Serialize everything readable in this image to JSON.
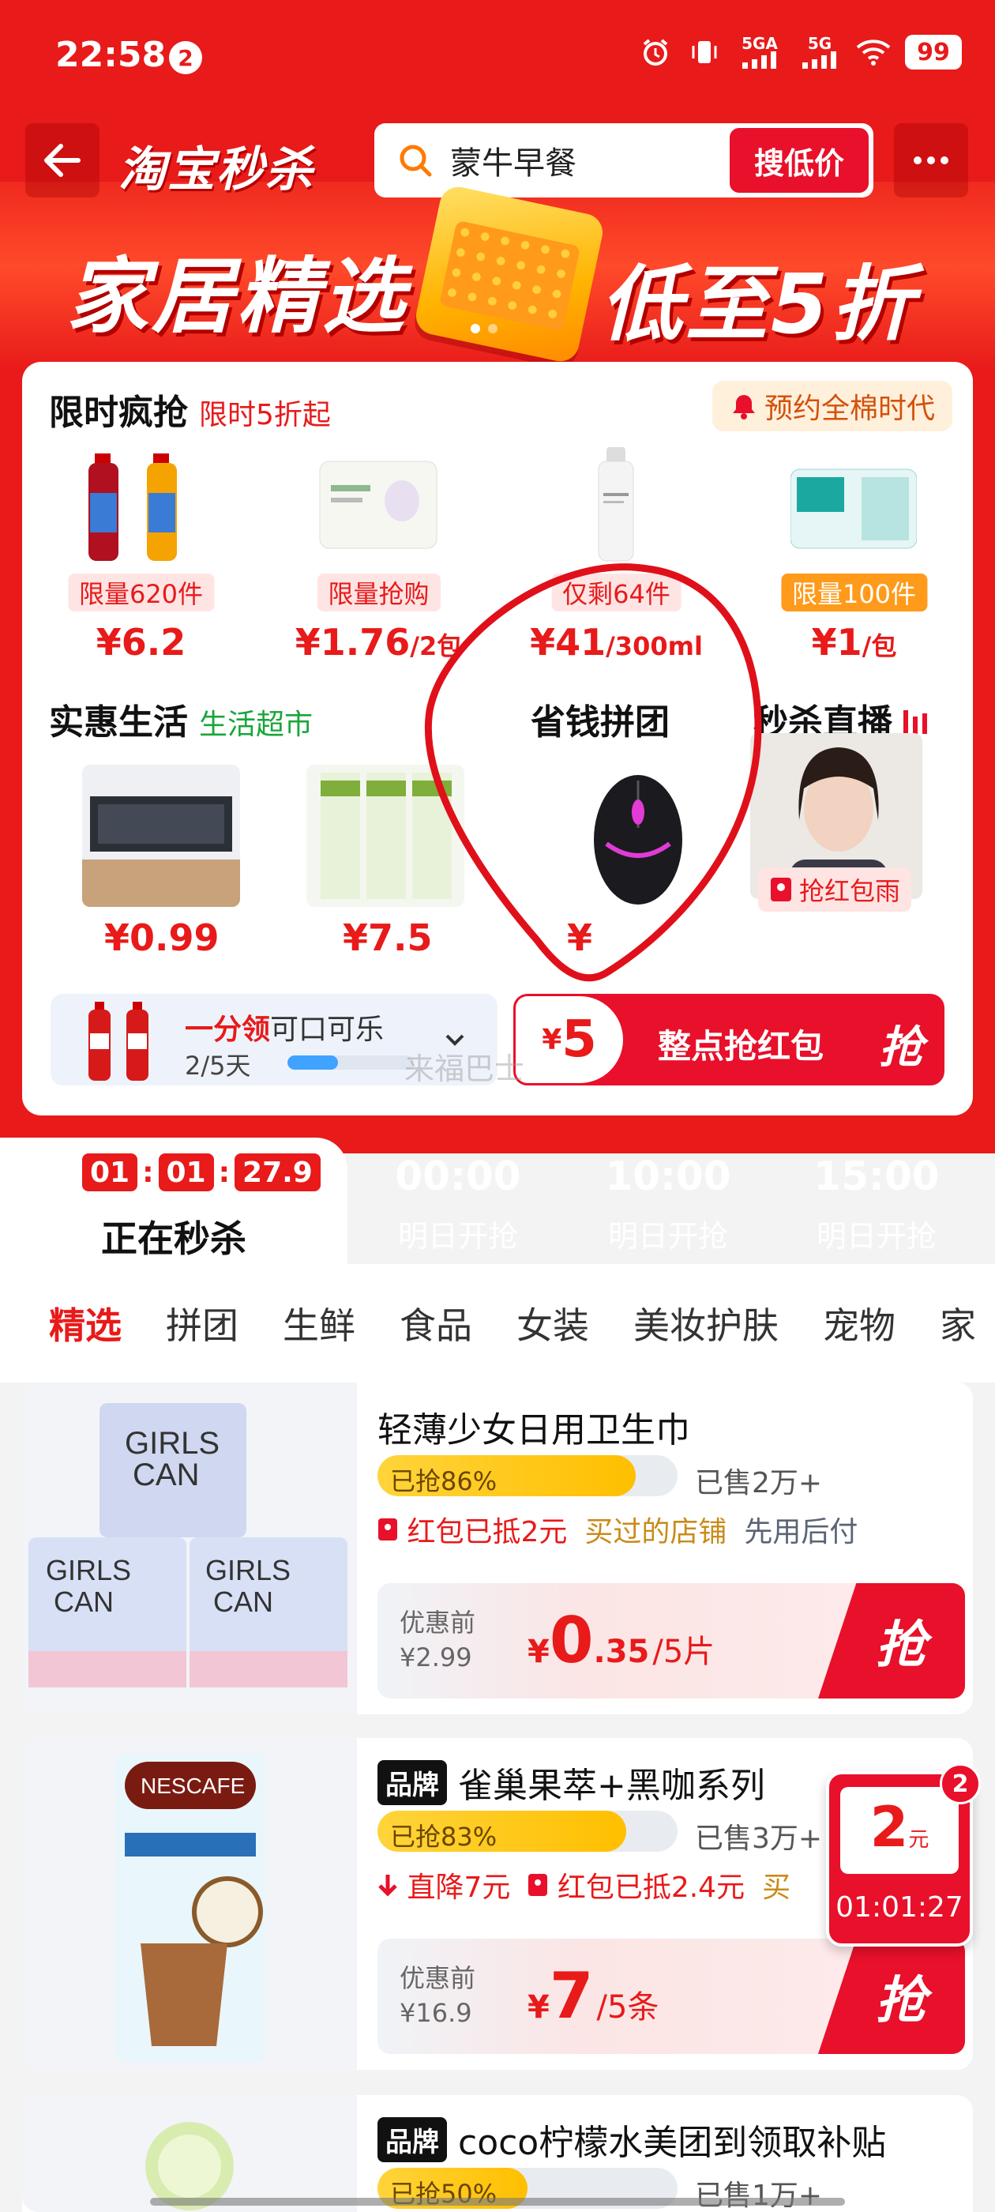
{
  "status_bar": {
    "time": "22:58",
    "notif_count": "2",
    "net1": "5GA",
    "net2": "5G",
    "battery": "99"
  },
  "nav": {
    "brand": "淘宝秒杀",
    "search_value": "蒙牛早餐",
    "search_button": "搜低价"
  },
  "banner": {
    "left_text": "家居精选",
    "right_text": "低至5折"
  },
  "flash_sale": {
    "title": "限时疯抢",
    "subtitle": "限时5折起",
    "reserve": "预约全棉时代",
    "items": [
      {
        "tag": "限量620件",
        "price": "¥6.2",
        "unit": ""
      },
      {
        "tag": "限量抢购",
        "price": "¥1.76",
        "unit": "/2包"
      },
      {
        "tag": "仅剩64件",
        "price": "¥41",
        "unit": "/300ml"
      },
      {
        "tag": "限量100件",
        "price": "¥1",
        "unit": "/包"
      }
    ]
  },
  "mid": {
    "life_title": "实惠生活",
    "life_sub": "生活超市",
    "life_prices": [
      "¥0.99",
      "¥7.5"
    ],
    "group_title": "省钱拼团",
    "group_price": "¥",
    "live_title": "秒杀直播",
    "live_tag": "抢红包雨"
  },
  "cola": {
    "title_red": "一分领",
    "title_rest": "可口可乐",
    "days": "2/5天",
    "progress": 0.4
  },
  "redpack": {
    "amount": "5",
    "currency": "¥",
    "text": "整点抢红包",
    "grab": "抢"
  },
  "watermark": "来福巴士",
  "time_tabs": {
    "countdown": [
      "01",
      "01",
      "27.9"
    ],
    "active_label": "正在秒杀",
    "slots": [
      {
        "time": "00:00",
        "label": "明日开抢"
      },
      {
        "time": "10:00",
        "label": "明日开抢"
      },
      {
        "time": "15:00",
        "label": "明日开抢"
      }
    ]
  },
  "categories": [
    "精选",
    "拼团",
    "生鲜",
    "食品",
    "女装",
    "美妆护肤",
    "宠物",
    "家"
  ],
  "products": [
    {
      "brand": "",
      "title": "轻薄少女日用卫生巾",
      "grabbed_label": "已抢86%",
      "grabbed": 0.86,
      "sold": "已售2万+",
      "tags": [
        {
          "text": "红包已抵2元",
          "tone": "red"
        },
        {
          "text": "买过的店铺",
          "tone": "gold"
        },
        {
          "text": "先用后付",
          "tone": "gray"
        }
      ],
      "orig_label": "优惠前",
      "orig_price": "¥2.99",
      "price_cur": "¥",
      "price_big": "0",
      "price_rest": ".35",
      "price_unit": "/5片",
      "grab": "抢"
    },
    {
      "brand": "品牌",
      "title": "雀巢果萃+黑咖系列",
      "grabbed_label": "已抢83%",
      "grabbed": 0.83,
      "sold": "已售3万+",
      "tags": [
        {
          "text": "直降7元",
          "tone": "red"
        },
        {
          "text": "红包已抵2.4元",
          "tone": "red"
        },
        {
          "text": "买",
          "tone": "gold"
        }
      ],
      "orig_label": "优惠前",
      "orig_price": "¥16.9",
      "price_cur": "¥",
      "price_big": "7",
      "price_rest": "",
      "price_unit": "/5条",
      "grab": "抢"
    },
    {
      "brand": "品牌",
      "title": "coco柠檬水美团到领取补贴",
      "grabbed_label": "已抢50%",
      "grabbed": 0.5,
      "sold": "已售1万+"
    }
  ],
  "float_coupon": {
    "amount": "2",
    "unit": "元",
    "countdown": "01:01:27",
    "badge": "2"
  },
  "colors": {
    "brand_red": "#e81a1a",
    "button_red": "#e8102a",
    "gold": "#c98b1a"
  }
}
